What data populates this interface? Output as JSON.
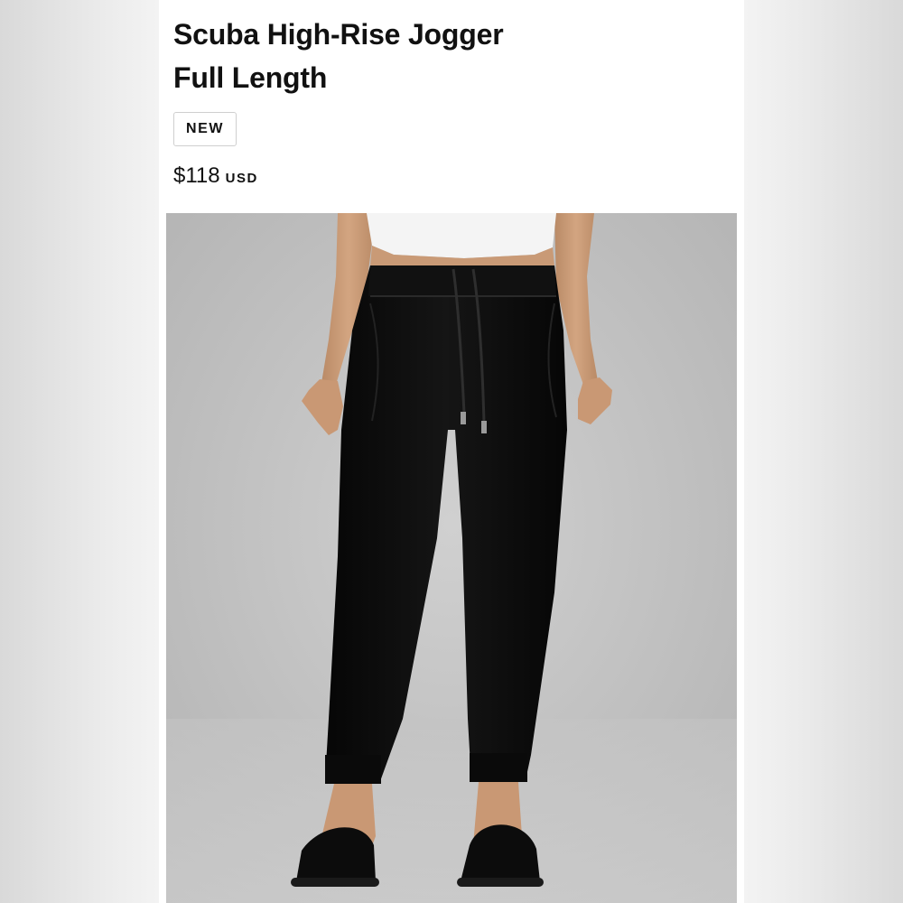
{
  "product": {
    "title_line1": "Scuba High-Rise Jogger",
    "title_line2": "Full Length",
    "badge": "NEW",
    "price": "$118",
    "currency": "USD"
  },
  "image": {
    "subject": "model-wearing-black-jogger-pants"
  },
  "colors": {
    "pants": "#0e0e0e",
    "backdrop": "#c9c9c9",
    "card": "#ffffff"
  }
}
